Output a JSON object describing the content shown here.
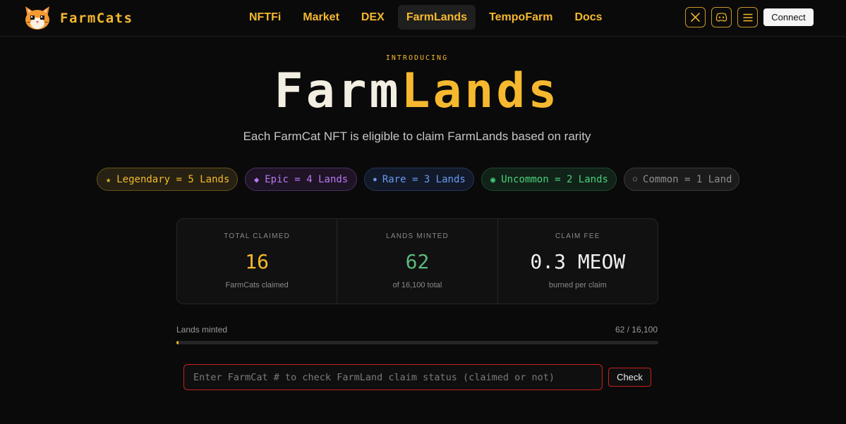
{
  "header": {
    "brand": "FarmCats",
    "nav": [
      {
        "label": "NFTFi"
      },
      {
        "label": "Market"
      },
      {
        "label": "DEX"
      },
      {
        "label": "FarmLands"
      },
      {
        "label": "TempoFarm"
      },
      {
        "label": "Docs"
      }
    ],
    "active_nav": "FarmLands",
    "icons": [
      "x-icon",
      "discord-icon",
      "menu-icon"
    ],
    "connect_label": "Connect"
  },
  "hero": {
    "kicker": "INTRODUCING",
    "title_part1": "Farm",
    "title_part2": "Lands",
    "subtitle": "Each FarmCat NFT is eligible to claim FarmLands based on rarity"
  },
  "rarities": [
    {
      "glyph": "★",
      "text": "Legendary = 5 Lands",
      "color": "#f5b82e"
    },
    {
      "glyph": "◆",
      "text": "Epic = 4 Lands",
      "color": "#b978f0"
    },
    {
      "glyph": "●",
      "text": "Rare = 3 Lands",
      "color": "#6a98f0"
    },
    {
      "glyph": "◉",
      "text": "Uncommon = 2 Lands",
      "color": "#49d17a"
    },
    {
      "glyph": "○",
      "text": "Common = 1 Land",
      "color": "#8d8d8d"
    }
  ],
  "stats": [
    {
      "label": "TOTAL CLAIMED",
      "value": "16",
      "sub": "FarmCats claimed",
      "color": "#f5b82e"
    },
    {
      "label": "LANDS MINTED",
      "value": "62",
      "sub": "of 16,100 total",
      "color": "#5cb87a"
    },
    {
      "label": "CLAIM FEE",
      "value": "0.3 MEOW",
      "sub": "burned per claim",
      "color": "#f0f0f0"
    }
  ],
  "progress": {
    "label": "Lands minted",
    "count_text": "62 / 16,100",
    "minted": 62,
    "total": 16100
  },
  "claim_check": {
    "placeholder": "Enter FarmCat # to check FarmLand claim status (claimed or not)",
    "value": "",
    "button_label": "Check"
  },
  "colors": {
    "accent": "#f5b82e",
    "background": "#0a0a0a",
    "error_border": "#c7201f"
  }
}
